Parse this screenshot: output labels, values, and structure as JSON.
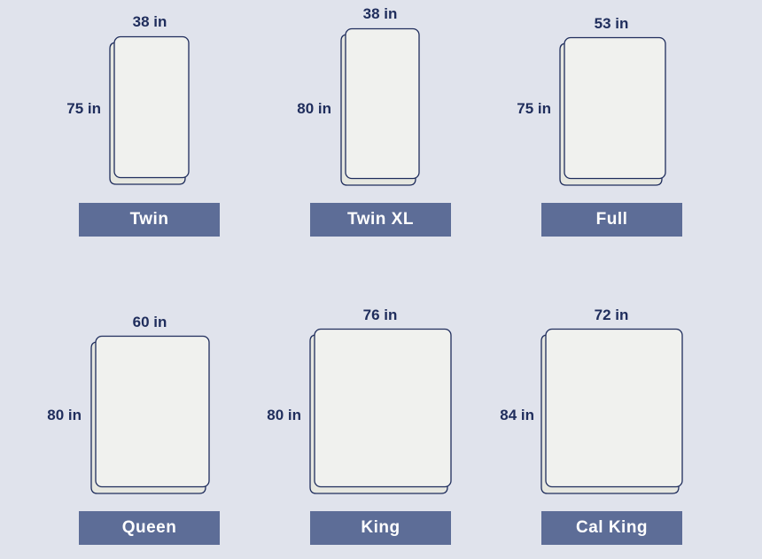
{
  "diagram_title": "",
  "colors": {
    "background": "#e0e3ec",
    "mattress_fill": "#f0f1ee",
    "mattress_side": "#e6e7e0",
    "outline": "#1f2d5c",
    "label_bg": "#5d6d97",
    "label_text": "#ffffff",
    "dimension_text": "#1f2d5c"
  },
  "mattresses": [
    {
      "name": "Twin",
      "width": "38 in",
      "length": "75 in"
    },
    {
      "name": "Twin XL",
      "width": "38 in",
      "length": "80 in"
    },
    {
      "name": "Full",
      "width": "53 in",
      "length": "75 in"
    },
    {
      "name": "Queen",
      "width": "60 in",
      "length": "80 in"
    },
    {
      "name": "King",
      "width": "76 in",
      "length": "80 in"
    },
    {
      "name": "Cal King",
      "width": "72 in",
      "length": "84 in"
    }
  ]
}
